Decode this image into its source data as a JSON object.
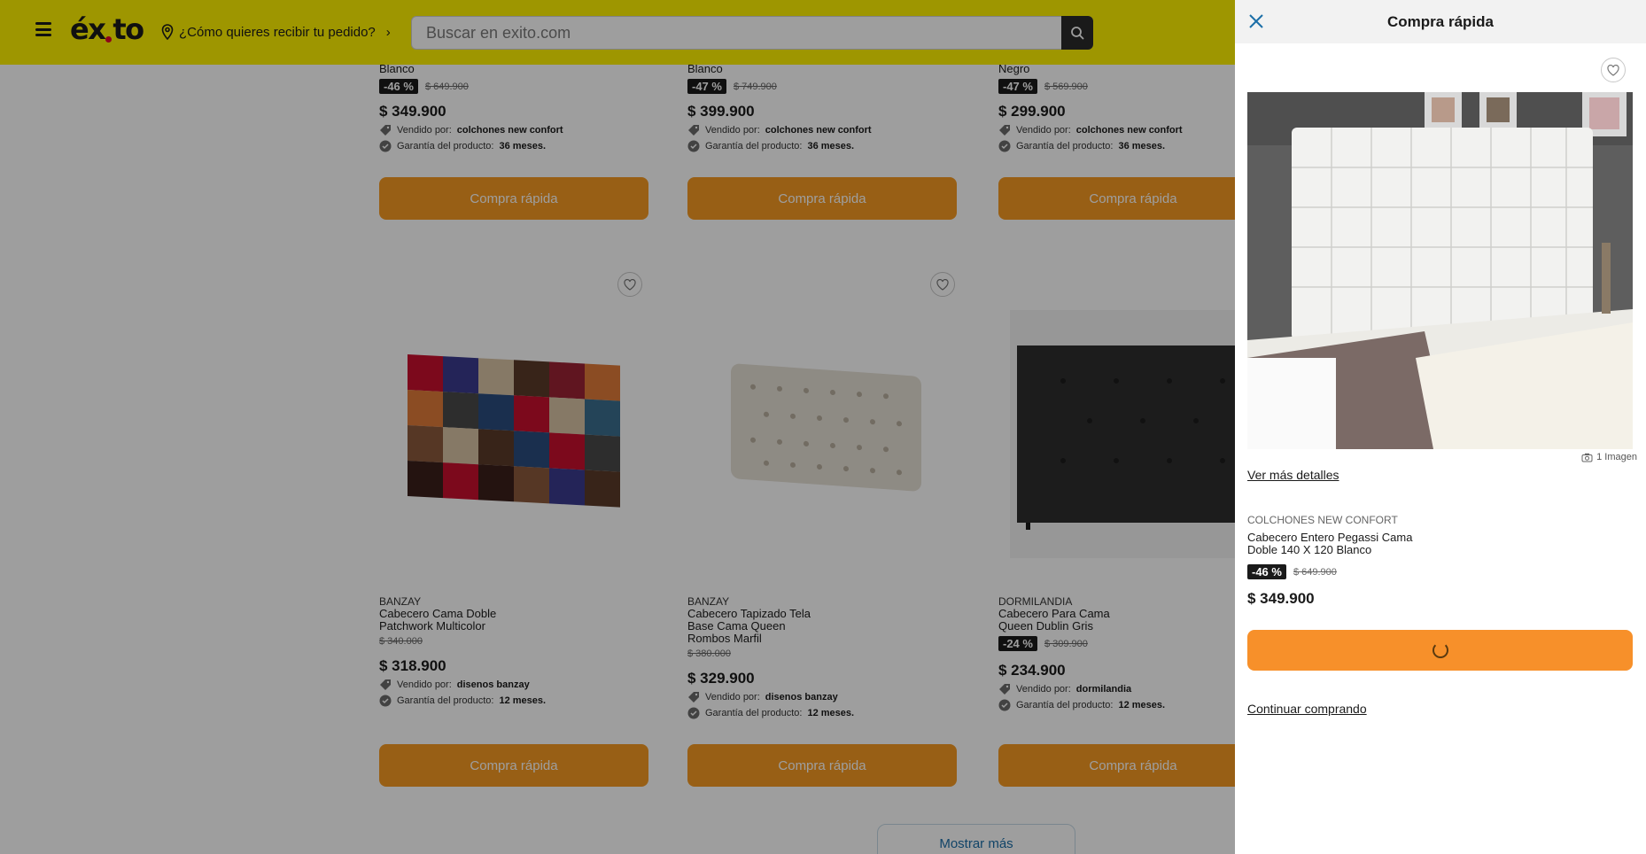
{
  "header": {
    "logo": "éxito",
    "location_prompt": "¿Cómo quieres recibir tu pedido?",
    "search_placeholder": "Buscar en exito.com",
    "brand_color": "#fff200"
  },
  "top_row": [
    {
      "title_tail": "Blanco",
      "discount": "-46 %",
      "old_price": "$ 649.900",
      "price": "$ 349.900",
      "seller_label": "Vendido por:",
      "seller": "colchones new confort",
      "warranty_label": "Garantía del producto:",
      "warranty": "36 meses.",
      "button": "Compra rápida"
    },
    {
      "title_tail": "Blanco",
      "discount": "-47 %",
      "old_price": "$ 749.900",
      "price": "$ 399.900",
      "seller_label": "Vendido por:",
      "seller": "colchones new confort",
      "warranty_label": "Garantía del producto:",
      "warranty": "36 meses.",
      "button": "Compra rápida"
    },
    {
      "title_tail": "Negro",
      "discount": "-47 %",
      "old_price": "$ 569.900",
      "price": "$ 299.900",
      "seller_label": "Vendido por:",
      "seller": "colchones new confort",
      "warranty_label": "Garantía del producto:",
      "warranty": "36 meses.",
      "button": "Compra rápida"
    }
  ],
  "bottom_row": [
    {
      "brand": "BANZAY",
      "title_1": "Cabecero Cama Doble",
      "title_2": "Patchwork Multicolor",
      "title_3": "",
      "discount": "",
      "old_price": "$ 340.000",
      "price": "$ 318.900",
      "seller_label": "Vendido por:",
      "seller": "disenos banzay",
      "warranty_label": "Garantía del producto:",
      "warranty": "12 meses.",
      "button": "Compra rápida"
    },
    {
      "brand": "BANZAY",
      "title_1": "Cabecero Tapizado Tela",
      "title_2": "Base Cama Queen",
      "title_3": "Rombos Marfil",
      "discount": "",
      "old_price": "$ 380.000",
      "price": "$ 329.900",
      "seller_label": "Vendido por:",
      "seller": "disenos banzay",
      "warranty_label": "Garantía del producto:",
      "warranty": "12 meses.",
      "button": "Compra rápida"
    },
    {
      "brand": "DORMILANDIA",
      "title_1": "Cabecero Para Cama",
      "title_2": "Queen Dublin Gris",
      "title_3": "",
      "discount": "-24 %",
      "old_price": "$ 309.900",
      "price": "$ 234.900",
      "seller_label": "Vendido por:",
      "seller": "dormilandia",
      "warranty_label": "Garantía del producto:",
      "warranty": "12 meses.",
      "button": "Compra rápida"
    }
  ],
  "more_button": "Mostrar más",
  "panel": {
    "title": "Compra rápida",
    "image_count": "1 Imagen",
    "details_link": "Ver más detalles",
    "seller": "COLCHONES NEW CONFORT",
    "product_title": "Cabecero Entero Pegassi Cama Doble 140 X 120 Blanco",
    "discount": "-46 %",
    "old_price": "$ 649.900",
    "price": "$ 349.900",
    "continue_link": "Continuar comprando",
    "cart_color": "#f7902a"
  }
}
